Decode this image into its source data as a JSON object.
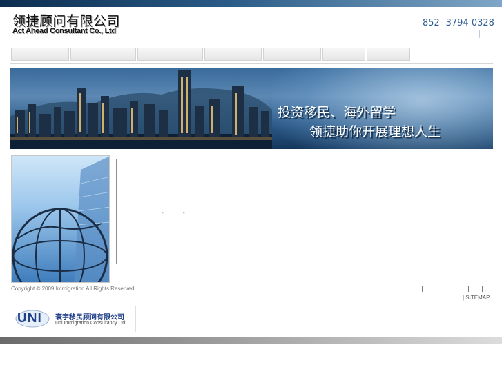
{
  "header": {
    "logo_cn": "领捷顾问有限公司",
    "logo_en": "Act Ahead Consultant Co., Ltd",
    "phone": "852- 3794 0328",
    "phone_separator": "|"
  },
  "nav": {
    "items": [
      "",
      "",
      "",
      "",
      "",
      "",
      ""
    ]
  },
  "banner": {
    "line1": "投资移民、海外留学",
    "line2": "领捷助你开展理想人生"
  },
  "content": {
    "dot1": "\"",
    "dot2": "\""
  },
  "footer": {
    "copyright": "Copyright © 2009 Immigration All Rights Reserved.",
    "link_separators": [
      "|",
      "|",
      "|",
      "|",
      "|"
    ],
    "sitemap": "| SITEMAP",
    "partner_cn": "寰宇移民顾问有限公司",
    "partner_en": "Uni Immigration Consultancy Ltd.",
    "partner_logo_text": "UNI"
  },
  "colors": {
    "accent": "#2e5e93",
    "partner_blue": "#1f3f88"
  }
}
